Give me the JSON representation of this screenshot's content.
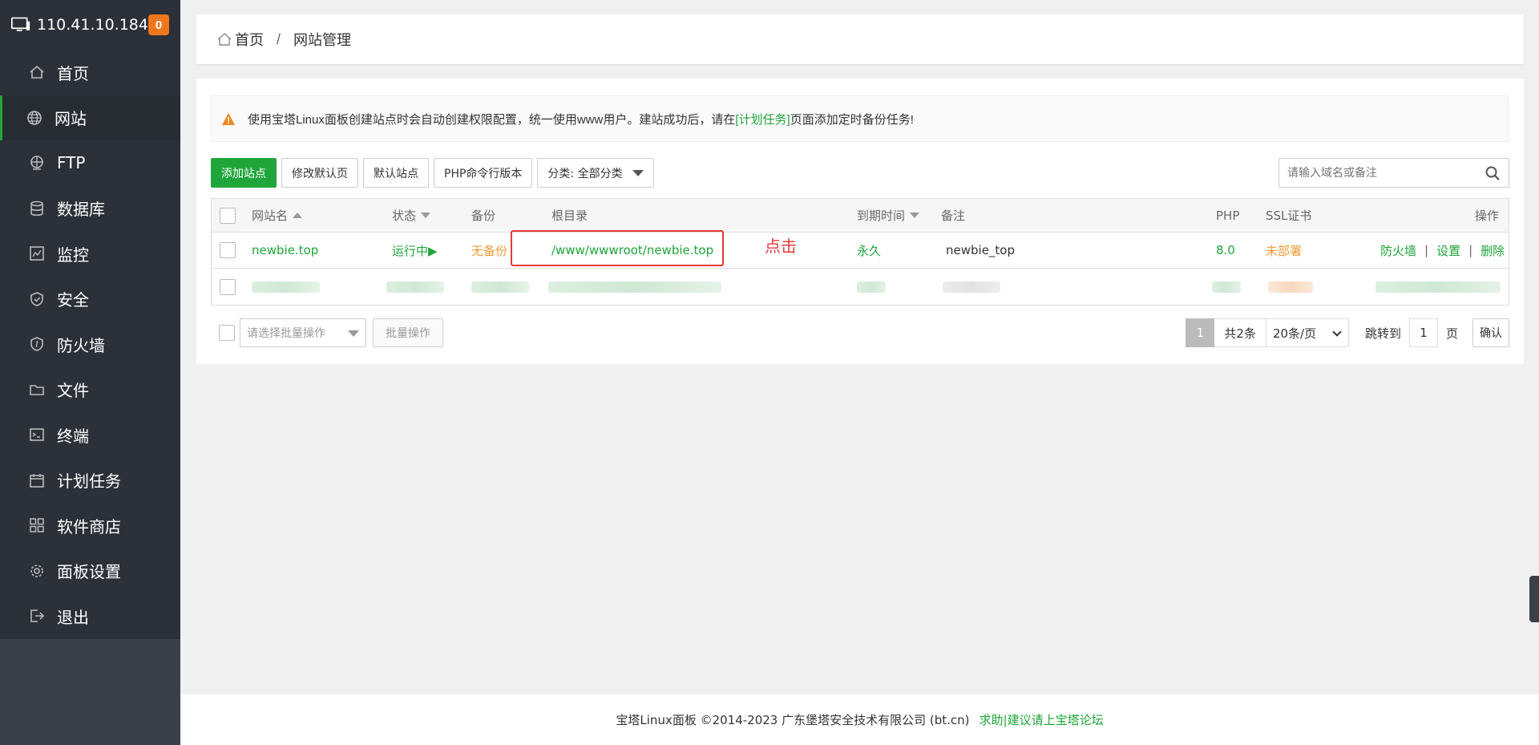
{
  "sidebar": {
    "ip": "110.41.10.184",
    "badge": "0",
    "items": [
      {
        "label": "首页",
        "icon": "home-icon"
      },
      {
        "label": "网站",
        "icon": "globe-icon"
      },
      {
        "label": "FTP",
        "icon": "ftp-icon"
      },
      {
        "label": "数据库",
        "icon": "database-icon"
      },
      {
        "label": "监控",
        "icon": "monitor-icon"
      },
      {
        "label": "安全",
        "icon": "shield-icon"
      },
      {
        "label": "防火墙",
        "icon": "firewall-icon"
      },
      {
        "label": "文件",
        "icon": "folder-icon"
      },
      {
        "label": "终端",
        "icon": "terminal-icon"
      },
      {
        "label": "计划任务",
        "icon": "calendar-icon"
      },
      {
        "label": "软件商店",
        "icon": "apps-icon"
      },
      {
        "label": "面板设置",
        "icon": "gear-icon"
      },
      {
        "label": "退出",
        "icon": "logout-icon"
      }
    ],
    "active": "网站"
  },
  "breadcrumb": {
    "home": "首页",
    "separator": "/",
    "current": "网站管理"
  },
  "alert": {
    "text_before": "使用宝塔Linux面板创建站点时会自动创建权限配置，统一使用www用户。建站成功后，请在",
    "link": "[计划任务]",
    "text_after": "页面添加定时备份任务!"
  },
  "toolbar": {
    "add_site": "添加站点",
    "edit_default_page": "修改默认页",
    "default_site": "默认站点",
    "php_cli_version": "PHP命令行版本",
    "category": "分类: 全部分类"
  },
  "search": {
    "placeholder": "请输入域名或备注"
  },
  "table": {
    "headers": {
      "name": "网站名",
      "status": "状态",
      "backup": "备份",
      "root": "根目录",
      "expire": "到期时间",
      "note": "备注",
      "php": "PHP",
      "ssl": "SSL证书",
      "ops": "操作"
    },
    "rows": [
      {
        "name": "newbie.top",
        "status": "运行中▶",
        "backup": "无备份",
        "root": "/www/wwwroot/newbie.top",
        "expire": "永久",
        "note": "newbie_top",
        "php": "8.0",
        "ssl": "未部署",
        "op_firewall": "防火墙",
        "op_settings": "设置",
        "op_delete": "删除",
        "op_sep": "|"
      }
    ]
  },
  "annotation": {
    "click_text": "点击"
  },
  "bottom": {
    "batch_placeholder": "请选择批量操作",
    "batch_button": "批量操作"
  },
  "pager": {
    "current": "1",
    "total": "共2条",
    "page_size": "20条/页",
    "jump_label": "跳转到",
    "jump_value": "1",
    "unit": "页",
    "confirm": "确认"
  },
  "footer": {
    "copyright": "宝塔Linux面板 ©2014-2023 广东堡塔安全技术有限公司 (bt.cn)",
    "link": "求助|建议请上宝塔论坛"
  },
  "colors": {
    "accent": "#20a53a",
    "warning": "#f39c3a",
    "sidebar": "#3b4048",
    "annotation": "#e53a3a"
  }
}
